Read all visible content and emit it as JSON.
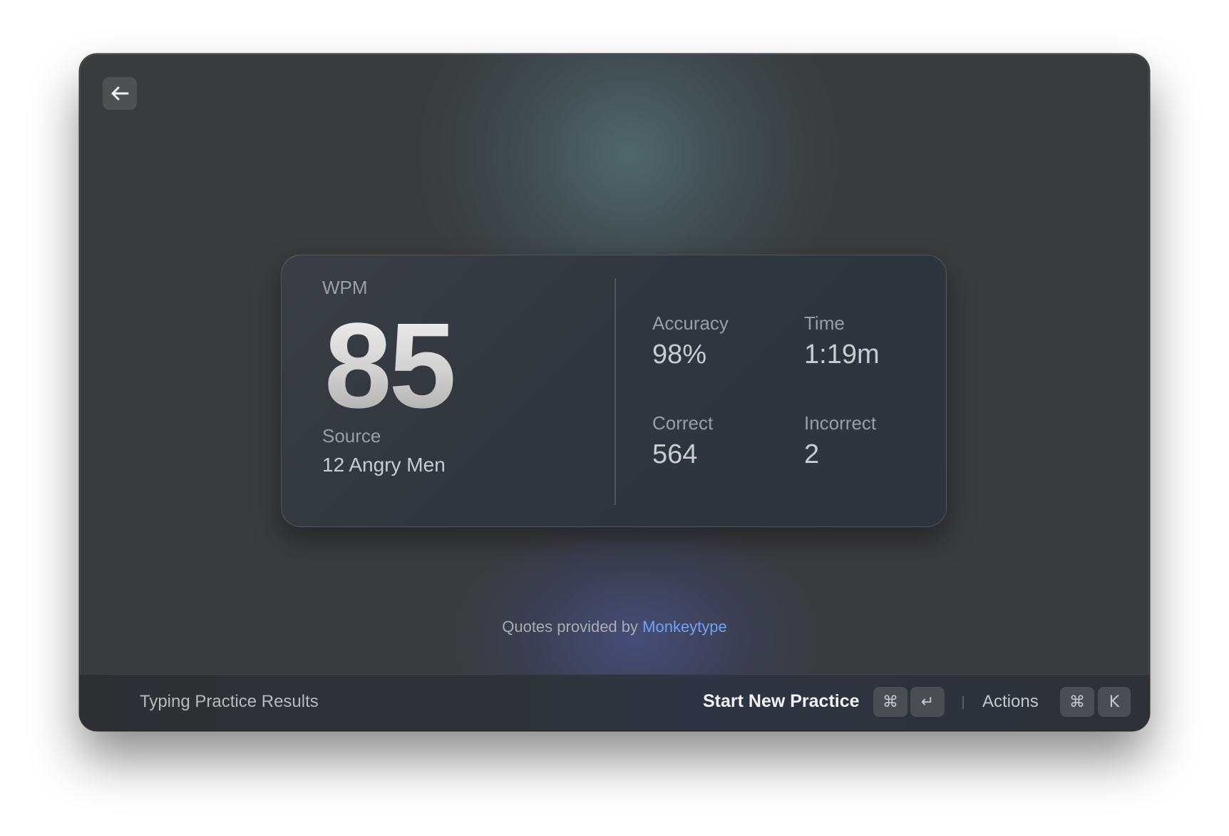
{
  "results": {
    "wpm_label": "WPM",
    "wpm_value": "85",
    "source_label": "Source",
    "source_value": "12 Angry Men",
    "stats": [
      {
        "label": "Accuracy",
        "value": "98%"
      },
      {
        "label": "Time",
        "value": "1:19m"
      },
      {
        "label": "Correct",
        "value": "564"
      },
      {
        "label": "Incorrect",
        "value": "2"
      }
    ]
  },
  "credit": {
    "prefix": "Quotes provided by",
    "link_label": "Monkeytype"
  },
  "footer": {
    "title": "Typing Practice Results",
    "primary_action": "Start New Practice",
    "primary_shortcut": [
      "⌘",
      "↵"
    ],
    "actions_label": "Actions",
    "actions_shortcut": [
      "⌘",
      "K"
    ]
  },
  "icons": {
    "back": "arrow-left-icon"
  },
  "colors": {
    "accent_link": "#6ea4f2",
    "window_bg": "#3a3b3d",
    "card_bg": "#30363d"
  }
}
